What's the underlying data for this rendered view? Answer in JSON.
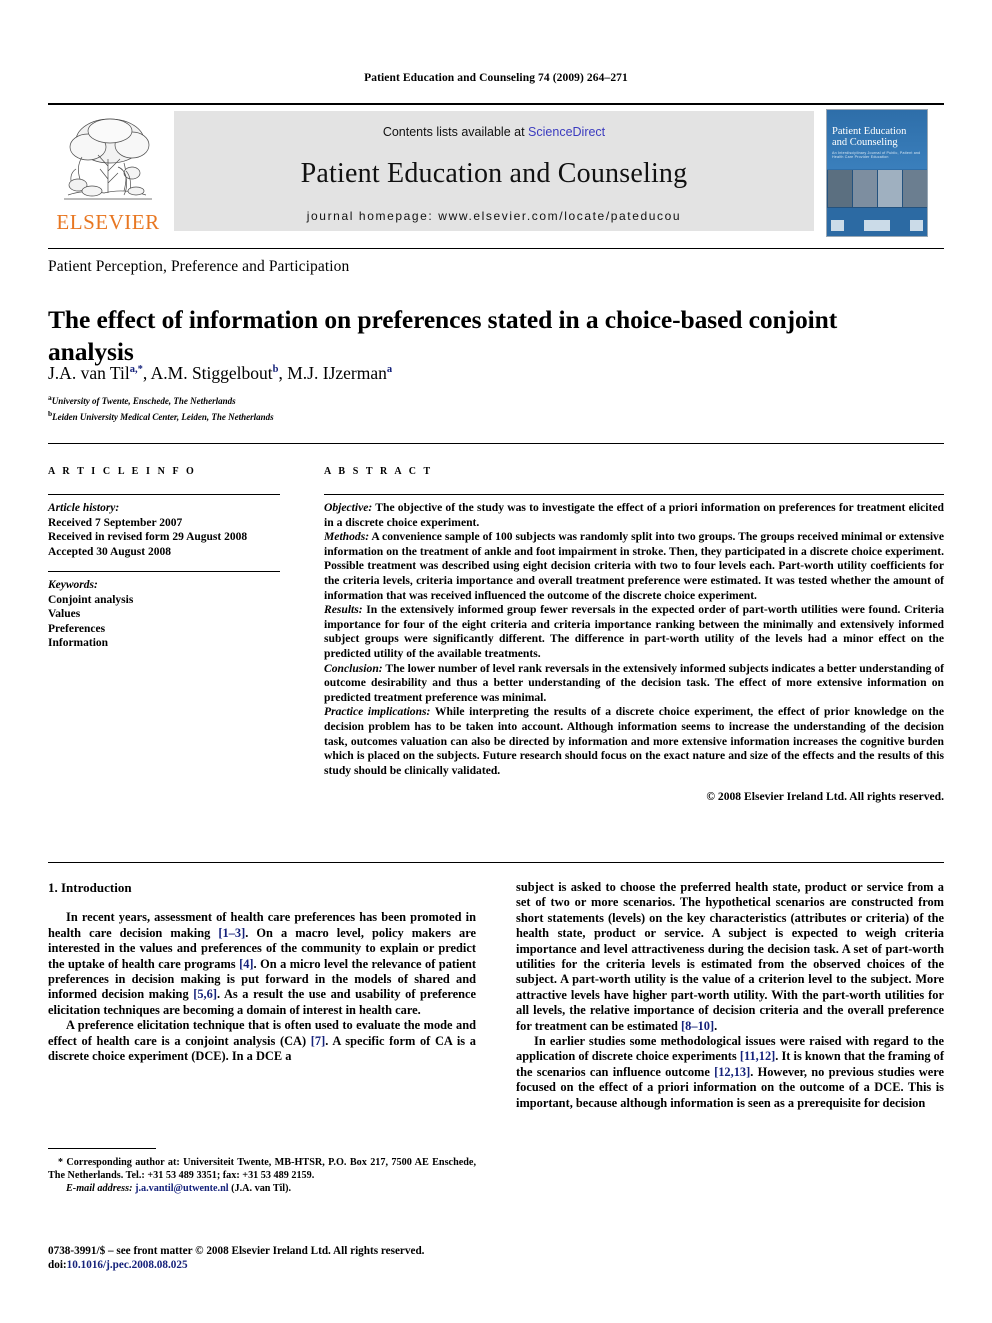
{
  "running_head": "Patient Education and Counseling 74 (2009) 264–271",
  "masthead": {
    "publisher_name": "ELSEVIER",
    "contents_prefix": "Contents lists available at",
    "sciencedirect": "ScienceDirect",
    "journal_title": "Patient Education and Counseling",
    "homepage": "journal homepage: www.elsevier.com/locate/pateducou",
    "cover": {
      "title": "Patient Education and Counseling",
      "subtitle": "An Interdisciplinary Journal of Public, Patient and Health Care Provider Education"
    }
  },
  "section_label": "Patient Perception, Preference and Participation",
  "title": "The effect of information on preferences stated in a choice-based conjoint analysis",
  "authors": [
    {
      "name": "J.A. van Til",
      "sup": "a,*"
    },
    {
      "name": "A.M. Stiggelbout",
      "sup": "b"
    },
    {
      "name": "M.J. IJzerman",
      "sup": "a"
    }
  ],
  "affiliations": [
    {
      "sup": "a",
      "text": "University of Twente, Enschede, The Netherlands"
    },
    {
      "sup": "b",
      "text": "Leiden University Medical Center, Leiden, The Netherlands"
    }
  ],
  "article_info": {
    "heading": "A R T I C L E  I N F O",
    "history_label": "Article history:",
    "history": [
      "Received 7 September 2007",
      "Received in revised form 29 August 2008",
      "Accepted 30 August 2008"
    ],
    "keywords_label": "Keywords:",
    "keywords": [
      "Conjoint analysis",
      "Values",
      "Preferences",
      "Information"
    ]
  },
  "abstract": {
    "heading": "A B S T R A C T",
    "objective_label": "Objective:",
    "objective": "The objective of the study was to investigate the effect of a priori information on preferences for treatment elicited in a discrete choice experiment.",
    "methods_label": "Methods:",
    "methods": "A convenience sample of 100 subjects was randomly split into two groups. The groups received minimal or extensive information on the treatment of ankle and foot impairment in stroke. Then, they participated in a discrete choice experiment. Possible treatment was described using eight decision criteria with two to four levels each. Part-worth utility coefficients for the criteria levels, criteria importance and overall treatment preference were estimated. It was tested whether the amount of information that was received influenced the outcome of the discrete choice experiment.",
    "results_label": "Results:",
    "results": "In the extensively informed group fewer reversals in the expected order of part-worth utilities were found. Criteria importance for four of the eight criteria and criteria importance ranking between the minimally and extensively informed subject groups were significantly different. The difference in part-worth utility of the levels had a minor effect on the predicted utility of the available treatments.",
    "conclusion_label": "Conclusion:",
    "conclusion": "The lower number of level rank reversals in the extensively informed subjects indicates a better understanding of outcome desirability and thus a better understanding of the decision task. The effect of more extensive information on predicted treatment preference was minimal.",
    "practice_label": "Practice implications:",
    "practice": "While interpreting the results of a discrete choice experiment, the effect of prior knowledge on the decision problem has to be taken into account. Although information seems to increase the understanding of the decision task, outcomes valuation can also be directed by information and more extensive information increases the cognitive burden which is placed on the subjects. Future research should focus on the exact nature and size of the effects and the results of this study should be clinically validated.",
    "copyright": "© 2008 Elsevier Ireland Ltd. All rights reserved."
  },
  "introduction": {
    "heading": "1. Introduction",
    "left_p1_a": "In recent years, assessment of health care preferences has been promoted in health care decision making ",
    "left_p1_r1": "[1–3]",
    "left_p1_b": ". On a macro level, policy makers are interested in the values and preferences of the community to explain or predict the uptake of health care programs ",
    "left_p1_r2": "[4]",
    "left_p1_c": ". On a micro level the relevance of patient preferences in decision making is put forward in the models of shared and informed decision making ",
    "left_p1_r3": "[5,6]",
    "left_p1_d": ". As a result the use and usability of preference elicitation techniques are becoming a domain of interest in health care.",
    "left_p2_a": "A preference elicitation technique that is often used to evaluate the mode and effect of health care is a conjoint analysis (CA) ",
    "left_p2_r1": "[7]",
    "left_p2_b": ". A specific form of CA is a discrete choice experiment (DCE). In a DCE a",
    "right_p1_a": "subject is asked to choose the preferred health state, product or service from a set of two or more scenarios. The hypothetical scenarios are constructed from short statements (levels) on the key characteristics (attributes or criteria) of the health state, product or service. A subject is expected to weigh criteria importance and level attractiveness during the decision task. A set of part-worth utilities for the criteria levels is estimated from the observed choices of the subject. A part-worth utility is the value of a criterion level to the subject. More attractive levels have higher part-worth utility. With the part-worth utilities for all levels, the relative importance of decision criteria and the overall preference for treatment can be estimated ",
    "right_p1_r1": "[8–10]",
    "right_p1_b": ".",
    "right_p2_a": "In earlier studies some methodological issues were raised with regard to the application of discrete choice experiments ",
    "right_p2_r1": "[11,12]",
    "right_p2_b": ". It is known that the framing of the scenarios can influence outcome ",
    "right_p2_r2": "[12,13]",
    "right_p2_c": ". However, no previous studies were focused on the effect of a priori information on the outcome of a DCE. This is important, because although information is seen as a prerequisite for decision"
  },
  "footnote": {
    "star": "*",
    "corresponding": "Corresponding author at: Universiteit Twente, MB-HTSR, P.O. Box 217, 7500 AE Enschede, The Netherlands. Tel.: +31 53 489 3351; fax: +31 53 489 2159.",
    "email_label": "E-mail address:",
    "email": "j.a.vantil@utwente.nl",
    "email_owner": "(J.A. van Til)."
  },
  "imprint": {
    "line1": "0738-3991/$ – see front matter © 2008 Elsevier Ireland Ltd. All rights reserved.",
    "doi_label": "doi:",
    "doi": "10.1016/j.pec.2008.08.025"
  }
}
